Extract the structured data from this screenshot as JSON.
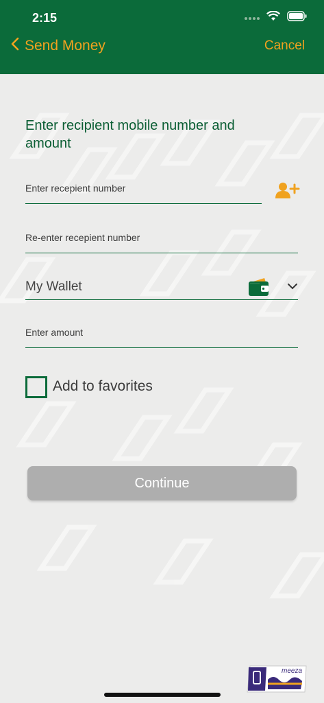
{
  "status_bar": {
    "time": "2:15"
  },
  "nav": {
    "back_label": "Send Money",
    "cancel_label": "Cancel"
  },
  "form": {
    "heading": "Enter recipient mobile number and amount",
    "recipient_placeholder": "Enter recepient number",
    "reenter_placeholder": "Re-enter recepient number",
    "wallet_value": "My Wallet",
    "amount_placeholder": "Enter amount",
    "favorites_label": "Add to favorites",
    "continue_label": "Continue"
  },
  "logo": {
    "text": "meeza"
  },
  "colors": {
    "brand_green": "#0b6b3a",
    "accent_orange": "#f0a21f",
    "disabled_button": "#aeaeae"
  },
  "icons": [
    "wifi-icon",
    "battery-icon",
    "back-chevron-icon",
    "add-contact-icon",
    "wallet-icon",
    "chevron-down-icon"
  ]
}
